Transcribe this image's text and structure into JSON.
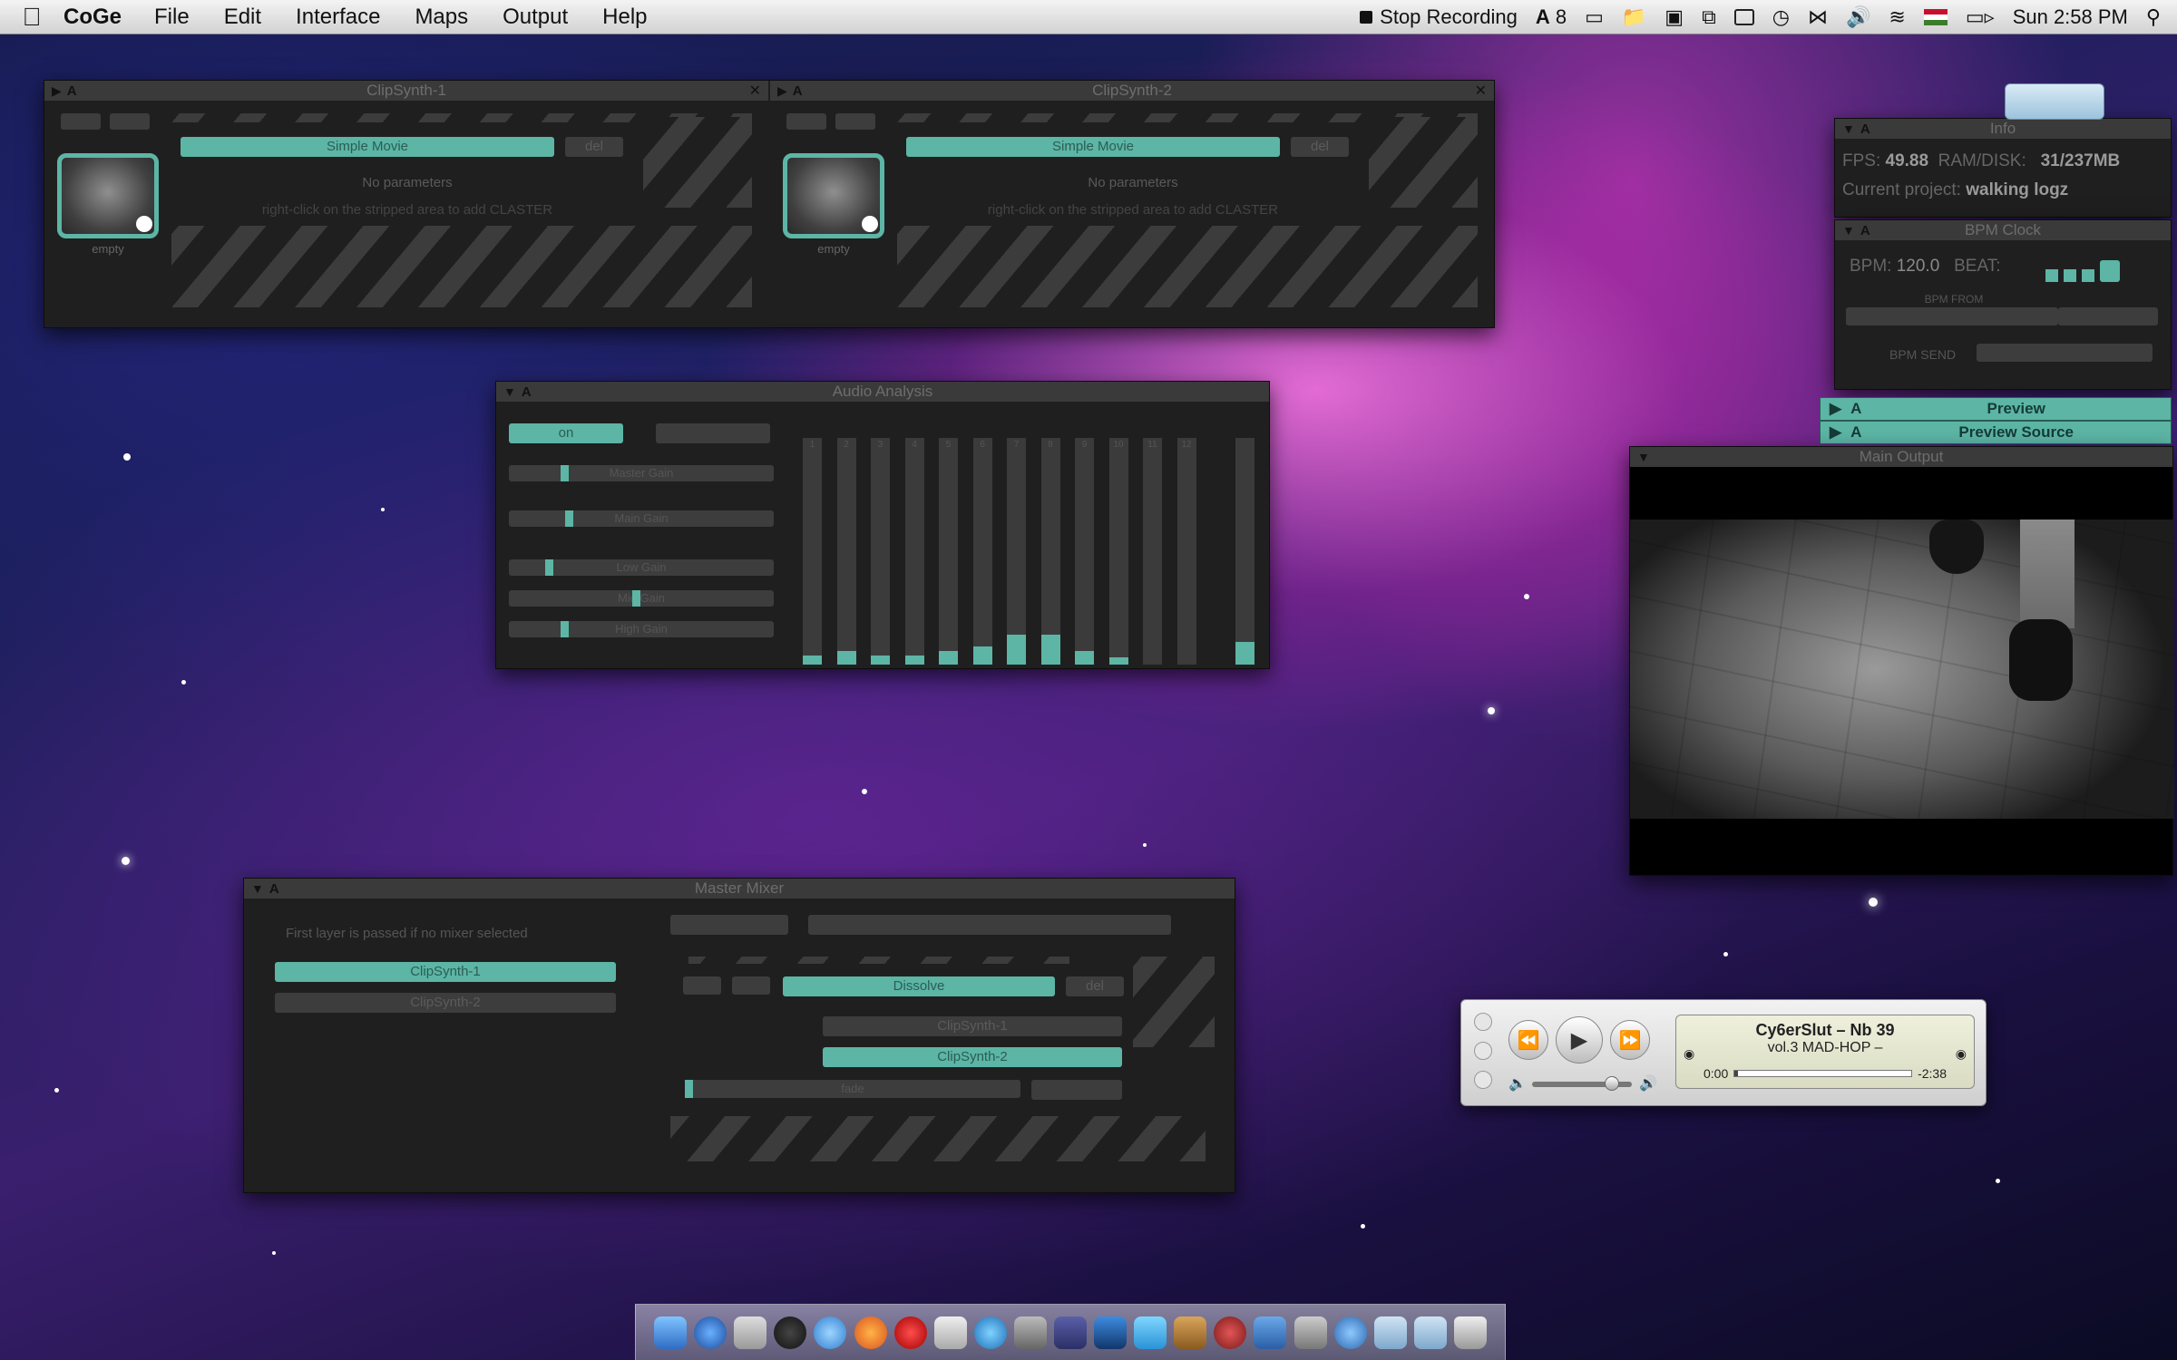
{
  "menubar": {
    "app_name": "CoGe",
    "menus": [
      "File",
      "Edit",
      "Interface",
      "Maps",
      "Output",
      "Help"
    ],
    "stop_recording": "Stop Recording",
    "adobe_badge": "8",
    "clock": "Sun 2:58 PM"
  },
  "clipsynth1": {
    "title": "ClipSynth-1",
    "letter": "A",
    "effect": "Simple Movie",
    "no_params": "No parameters",
    "hint": "right-click on the stripped area to add CLASTER",
    "thumb_label": "empty"
  },
  "clipsynth2": {
    "title": "ClipSynth-2",
    "letter": "A",
    "effect": "Simple Movie",
    "no_params": "No parameters",
    "hint": "right-click on the stripped area to add CLASTER",
    "thumb_label": "empty"
  },
  "audio": {
    "title": "Audio Analysis",
    "letter": "A",
    "on_label": "on",
    "gains": [
      "Master Gain",
      "Main Gain",
      "Low Gain",
      "Mid Gain",
      "High Gain"
    ],
    "gain_levels": [
      0.2,
      0.22,
      0.14,
      0.48,
      0.2
    ],
    "bands": [
      {
        "n": "1",
        "level": 0.04
      },
      {
        "n": "2",
        "level": 0.06
      },
      {
        "n": "3",
        "level": 0.04
      },
      {
        "n": "4",
        "level": 0.04
      },
      {
        "n": "5",
        "level": 0.06
      },
      {
        "n": "6",
        "level": 0.08
      },
      {
        "n": "7",
        "level": 0.13
      },
      {
        "n": "8",
        "level": 0.13
      },
      {
        "n": "9",
        "level": 0.06
      },
      {
        "n": "10",
        "level": 0.03
      },
      {
        "n": "11",
        "level": 0.0
      },
      {
        "n": "12",
        "level": 0.0
      }
    ],
    "master_level": 0.1
  },
  "mixer": {
    "title": "Master Mixer",
    "letter": "A",
    "hint": "First layer is passed if no mixer selected",
    "layers": [
      "ClipSynth-1",
      "ClipSynth-2"
    ],
    "effect": "Dissolve",
    "layer_a": "ClipSynth-1",
    "layer_b": "ClipSynth-2",
    "fade_label": "fade"
  },
  "info": {
    "title": "Info",
    "letter": "A",
    "fps_label": "FPS:",
    "fps": "49.88",
    "ram_label": "RAM/DISK:",
    "ram": "31/237MB",
    "project_label": "Current project:",
    "project": "walking logz"
  },
  "bpm": {
    "title": "BPM Clock",
    "letter": "A",
    "bpm_label": "BPM:",
    "bpm": "120.0",
    "beat_label": "BEAT:",
    "bpm_from": "BPM FROM",
    "bpm_send": "BPM SEND"
  },
  "preview": {
    "letter": "A",
    "label": "Preview"
  },
  "preview_source": {
    "letter": "A",
    "label": "Preview Source"
  },
  "main_output": {
    "title": "Main Output"
  },
  "itunes": {
    "track": "Cy6erSlut – Nb 39",
    "album": "vol.3   MAD-HOP –",
    "elapsed": "0:00",
    "remaining": "-2:38",
    "progress": 0.02,
    "volume": 0.85
  }
}
